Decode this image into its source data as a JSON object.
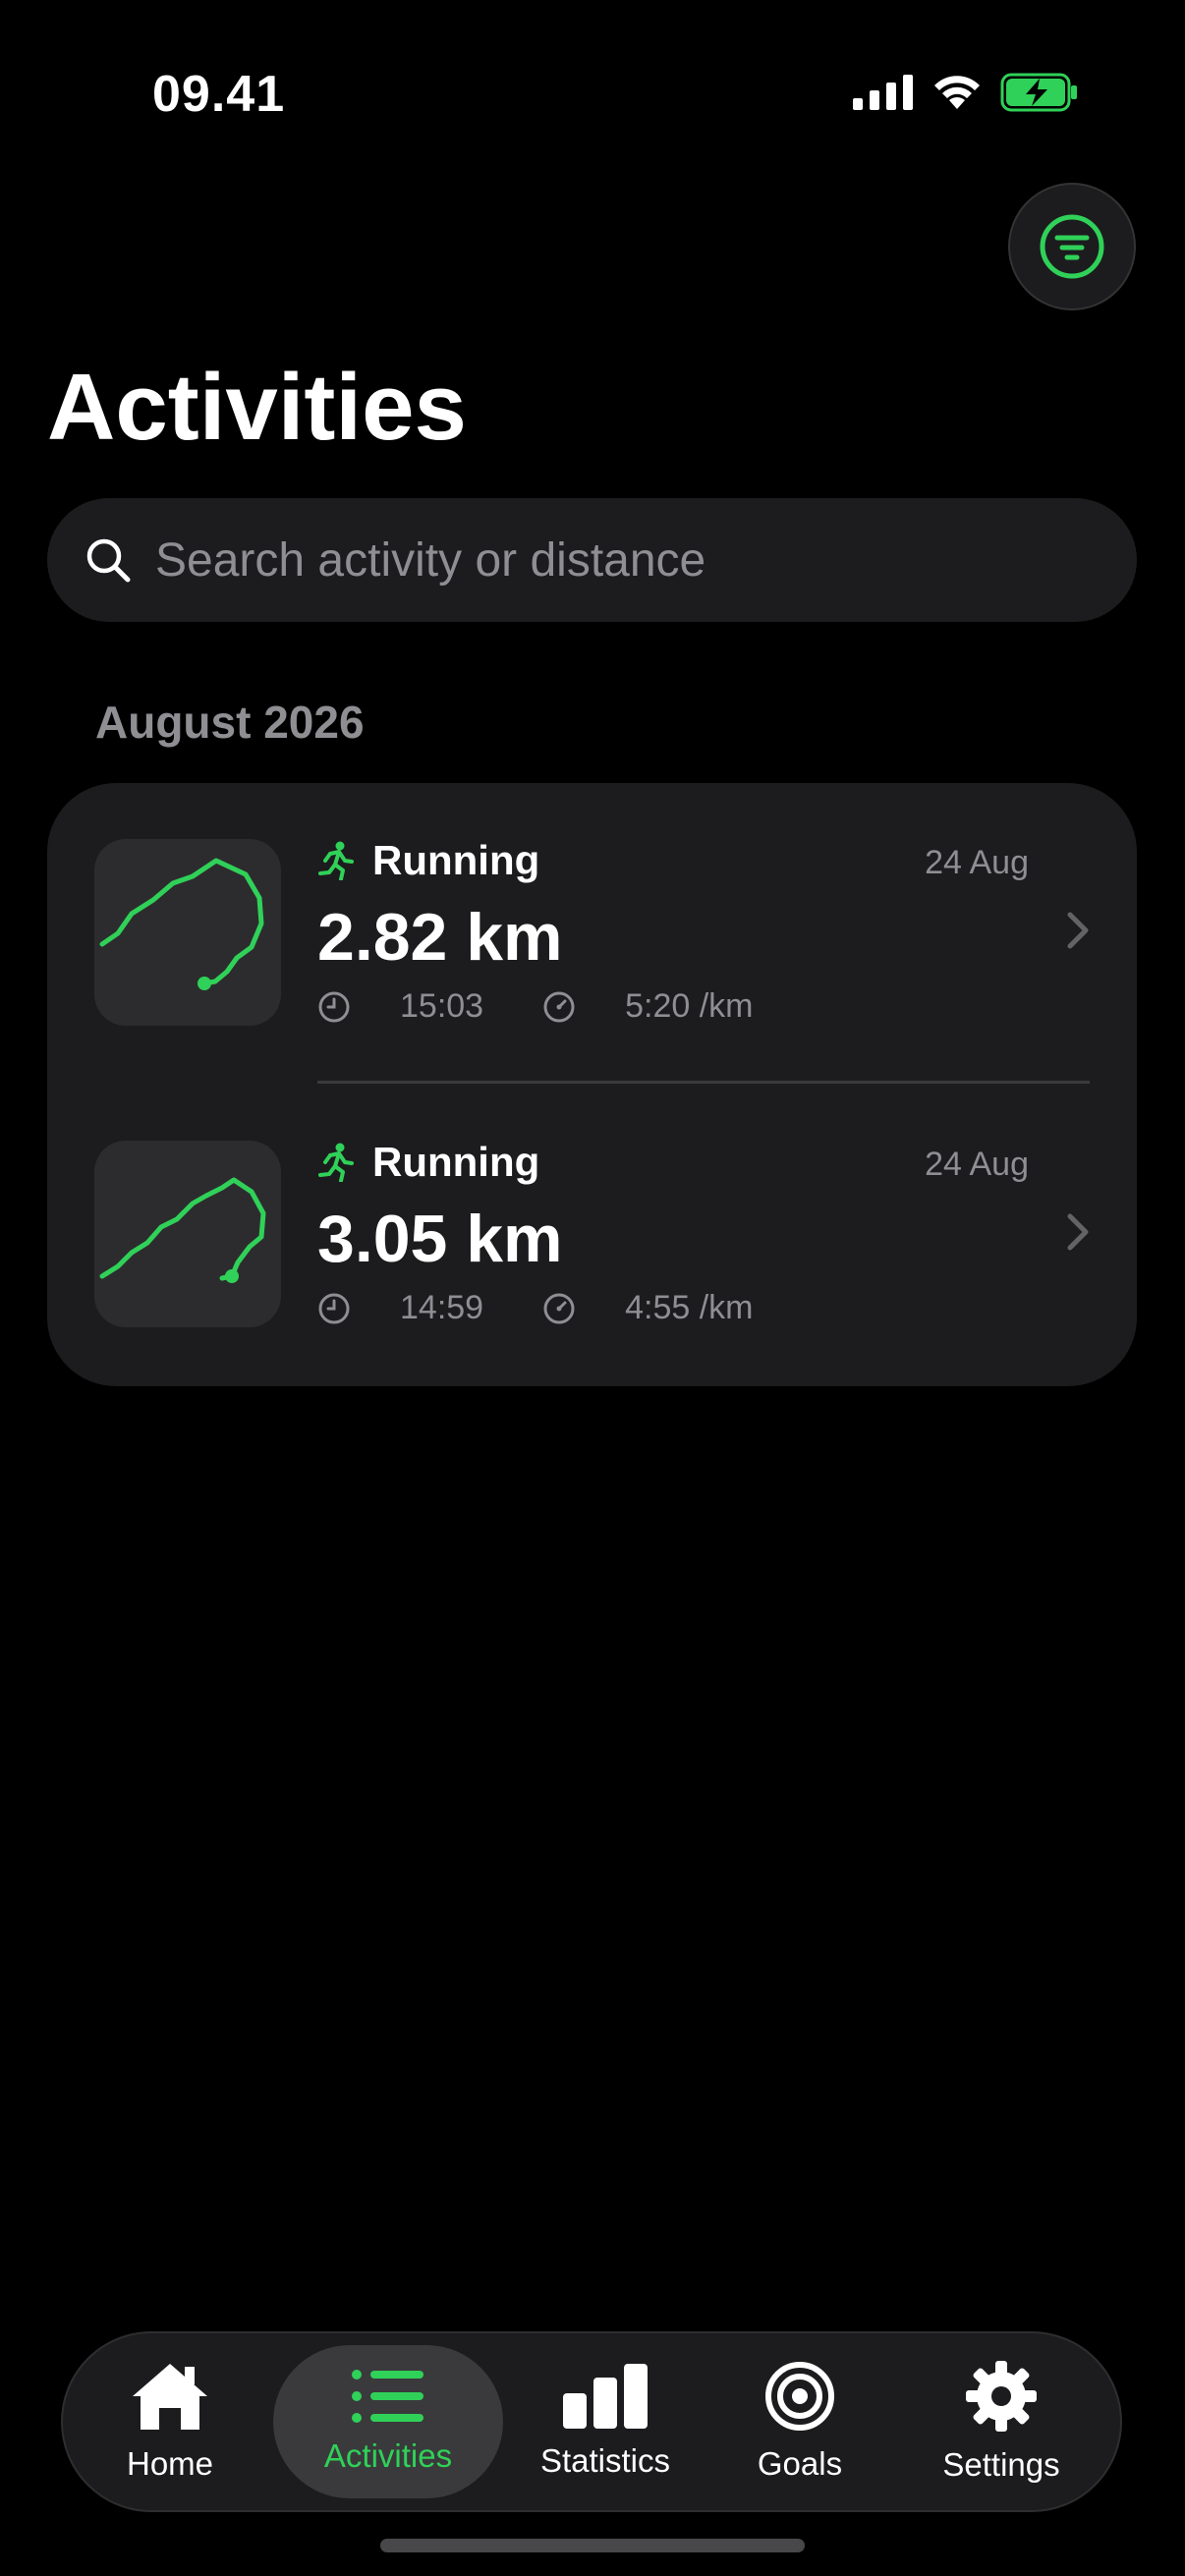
{
  "colors": {
    "accent": "#30d158",
    "background": "#000000",
    "card": "#1c1c1e",
    "secondary_text": "#8e8e93"
  },
  "status_bar": {
    "time": "09.41",
    "icons": [
      "cellular-signal-icon",
      "wifi-icon",
      "battery-charging-icon"
    ]
  },
  "header": {
    "title": "Activities",
    "filter_icon": "filter-icon"
  },
  "search": {
    "placeholder": "Search activity or distance",
    "value": "",
    "icon": "search-icon"
  },
  "section": {
    "title": "August 2026"
  },
  "activities": [
    {
      "type": "Running",
      "date": "24 Aug",
      "distance": "2.82 km",
      "duration": "15:03",
      "pace": "5:20 /km"
    },
    {
      "type": "Running",
      "date": "24 Aug",
      "distance": "3.05 km",
      "duration": "14:59",
      "pace": "4:55 /km"
    }
  ],
  "tab_bar": {
    "active": "Activities",
    "tabs": [
      {
        "label": "Home",
        "icon": "home-icon"
      },
      {
        "label": "Activities",
        "icon": "list-icon"
      },
      {
        "label": "Statistics",
        "icon": "bar-chart-icon"
      },
      {
        "label": "Goals",
        "icon": "target-icon"
      },
      {
        "label": "Settings",
        "icon": "gear-icon"
      }
    ]
  }
}
